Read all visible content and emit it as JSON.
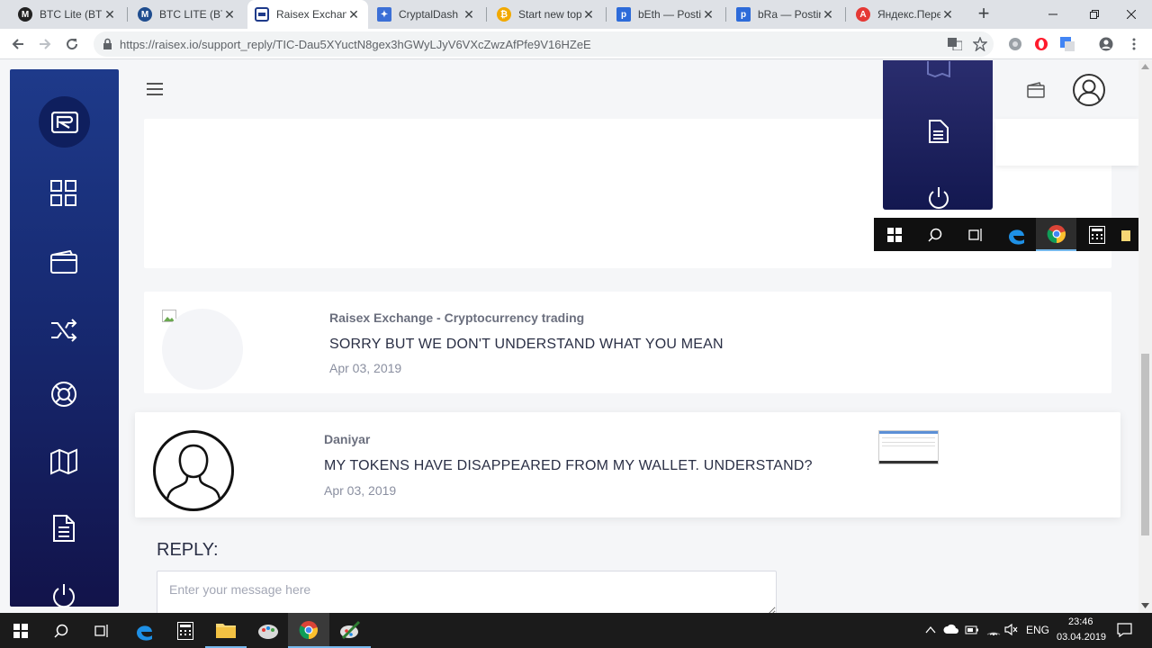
{
  "browser": {
    "tabs": [
      {
        "title": "BTC Lite (BTCL)",
        "icon": "btc-lite-icon",
        "color": "#222"
      },
      {
        "title": "BTC LITE (BTCL)",
        "icon": "btc-lite-icon",
        "color": "#1f4d8f"
      },
      {
        "title": "Raisex Exchange",
        "icon": "raisex-icon",
        "color": "#1e3a8a",
        "active": true
      },
      {
        "title": "CryptalDash Ex",
        "icon": "cryptaldash-icon",
        "color": "#3b6fd6"
      },
      {
        "title": "Start new topic",
        "icon": "coin-icon",
        "color": "#f2a900"
      },
      {
        "title": "bEth — Postim",
        "icon": "postimage-icon",
        "color": "#2d6bd9"
      },
      {
        "title": "bRa — Postim",
        "icon": "postimage-icon",
        "color": "#2d6bd9"
      },
      {
        "title": "Яндекс.Перев",
        "icon": "yandex-translate-icon",
        "color": "#e53935"
      }
    ],
    "url": "https://raisex.io/support_reply/TIC-Dau5XYuctN8gex3hGWyLJyV6VXcZwzAfPfe9V16HZeE"
  },
  "page": {
    "messages": [
      {
        "author": "Raisex Exchange - Cryptocurrency trading",
        "text": "SORRY BUT WE DON'T UNDERSTAND WHAT YOU MEAN",
        "date": "Apr 03, 2019"
      },
      {
        "author": "Daniyar",
        "text": "MY TOKENS HAVE DISAPPEARED FROM MY WALLET. UNDERSTAND?",
        "date": "Apr 03, 2019"
      }
    ],
    "reply": {
      "label": "REPLY:",
      "placeholder": "Enter your message here"
    }
  },
  "taskbar": {
    "language": "ENG",
    "time": "23:46",
    "date": "03.04.2019"
  },
  "colors": {
    "sidebar_top": "#1e3a8a",
    "sidebar_bottom": "#12134a",
    "text_dark": "#2a2f45"
  }
}
